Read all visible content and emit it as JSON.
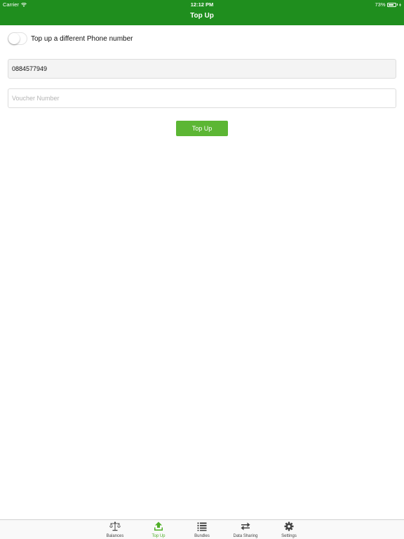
{
  "status_bar": {
    "carrier": "Carrier",
    "time": "12:12 PM",
    "battery_percent": "73%",
    "battery_level": 0.73
  },
  "nav": {
    "title": "Top Up"
  },
  "form": {
    "toggle_label": "Top up a different Phone number",
    "toggle_on": false,
    "phone_value": "0884577949",
    "voucher_placeholder": "Voucher Number",
    "voucher_value": "",
    "submit_label": "Top Up"
  },
  "tabs": [
    {
      "label": "Balances",
      "icon": "scale-icon",
      "active": false
    },
    {
      "label": "Top Up",
      "icon": "upload-icon",
      "active": true
    },
    {
      "label": "Bundles",
      "icon": "list-icon",
      "active": false
    },
    {
      "label": "Data Sharing",
      "icon": "transfer-arrows-icon",
      "active": false
    },
    {
      "label": "Settings",
      "icon": "gear-icon",
      "active": false
    }
  ],
  "colors": {
    "header": "#1f8e1e",
    "button": "#5cb634",
    "active_tab": "#4fae27",
    "inactive_tab": "#444444"
  }
}
